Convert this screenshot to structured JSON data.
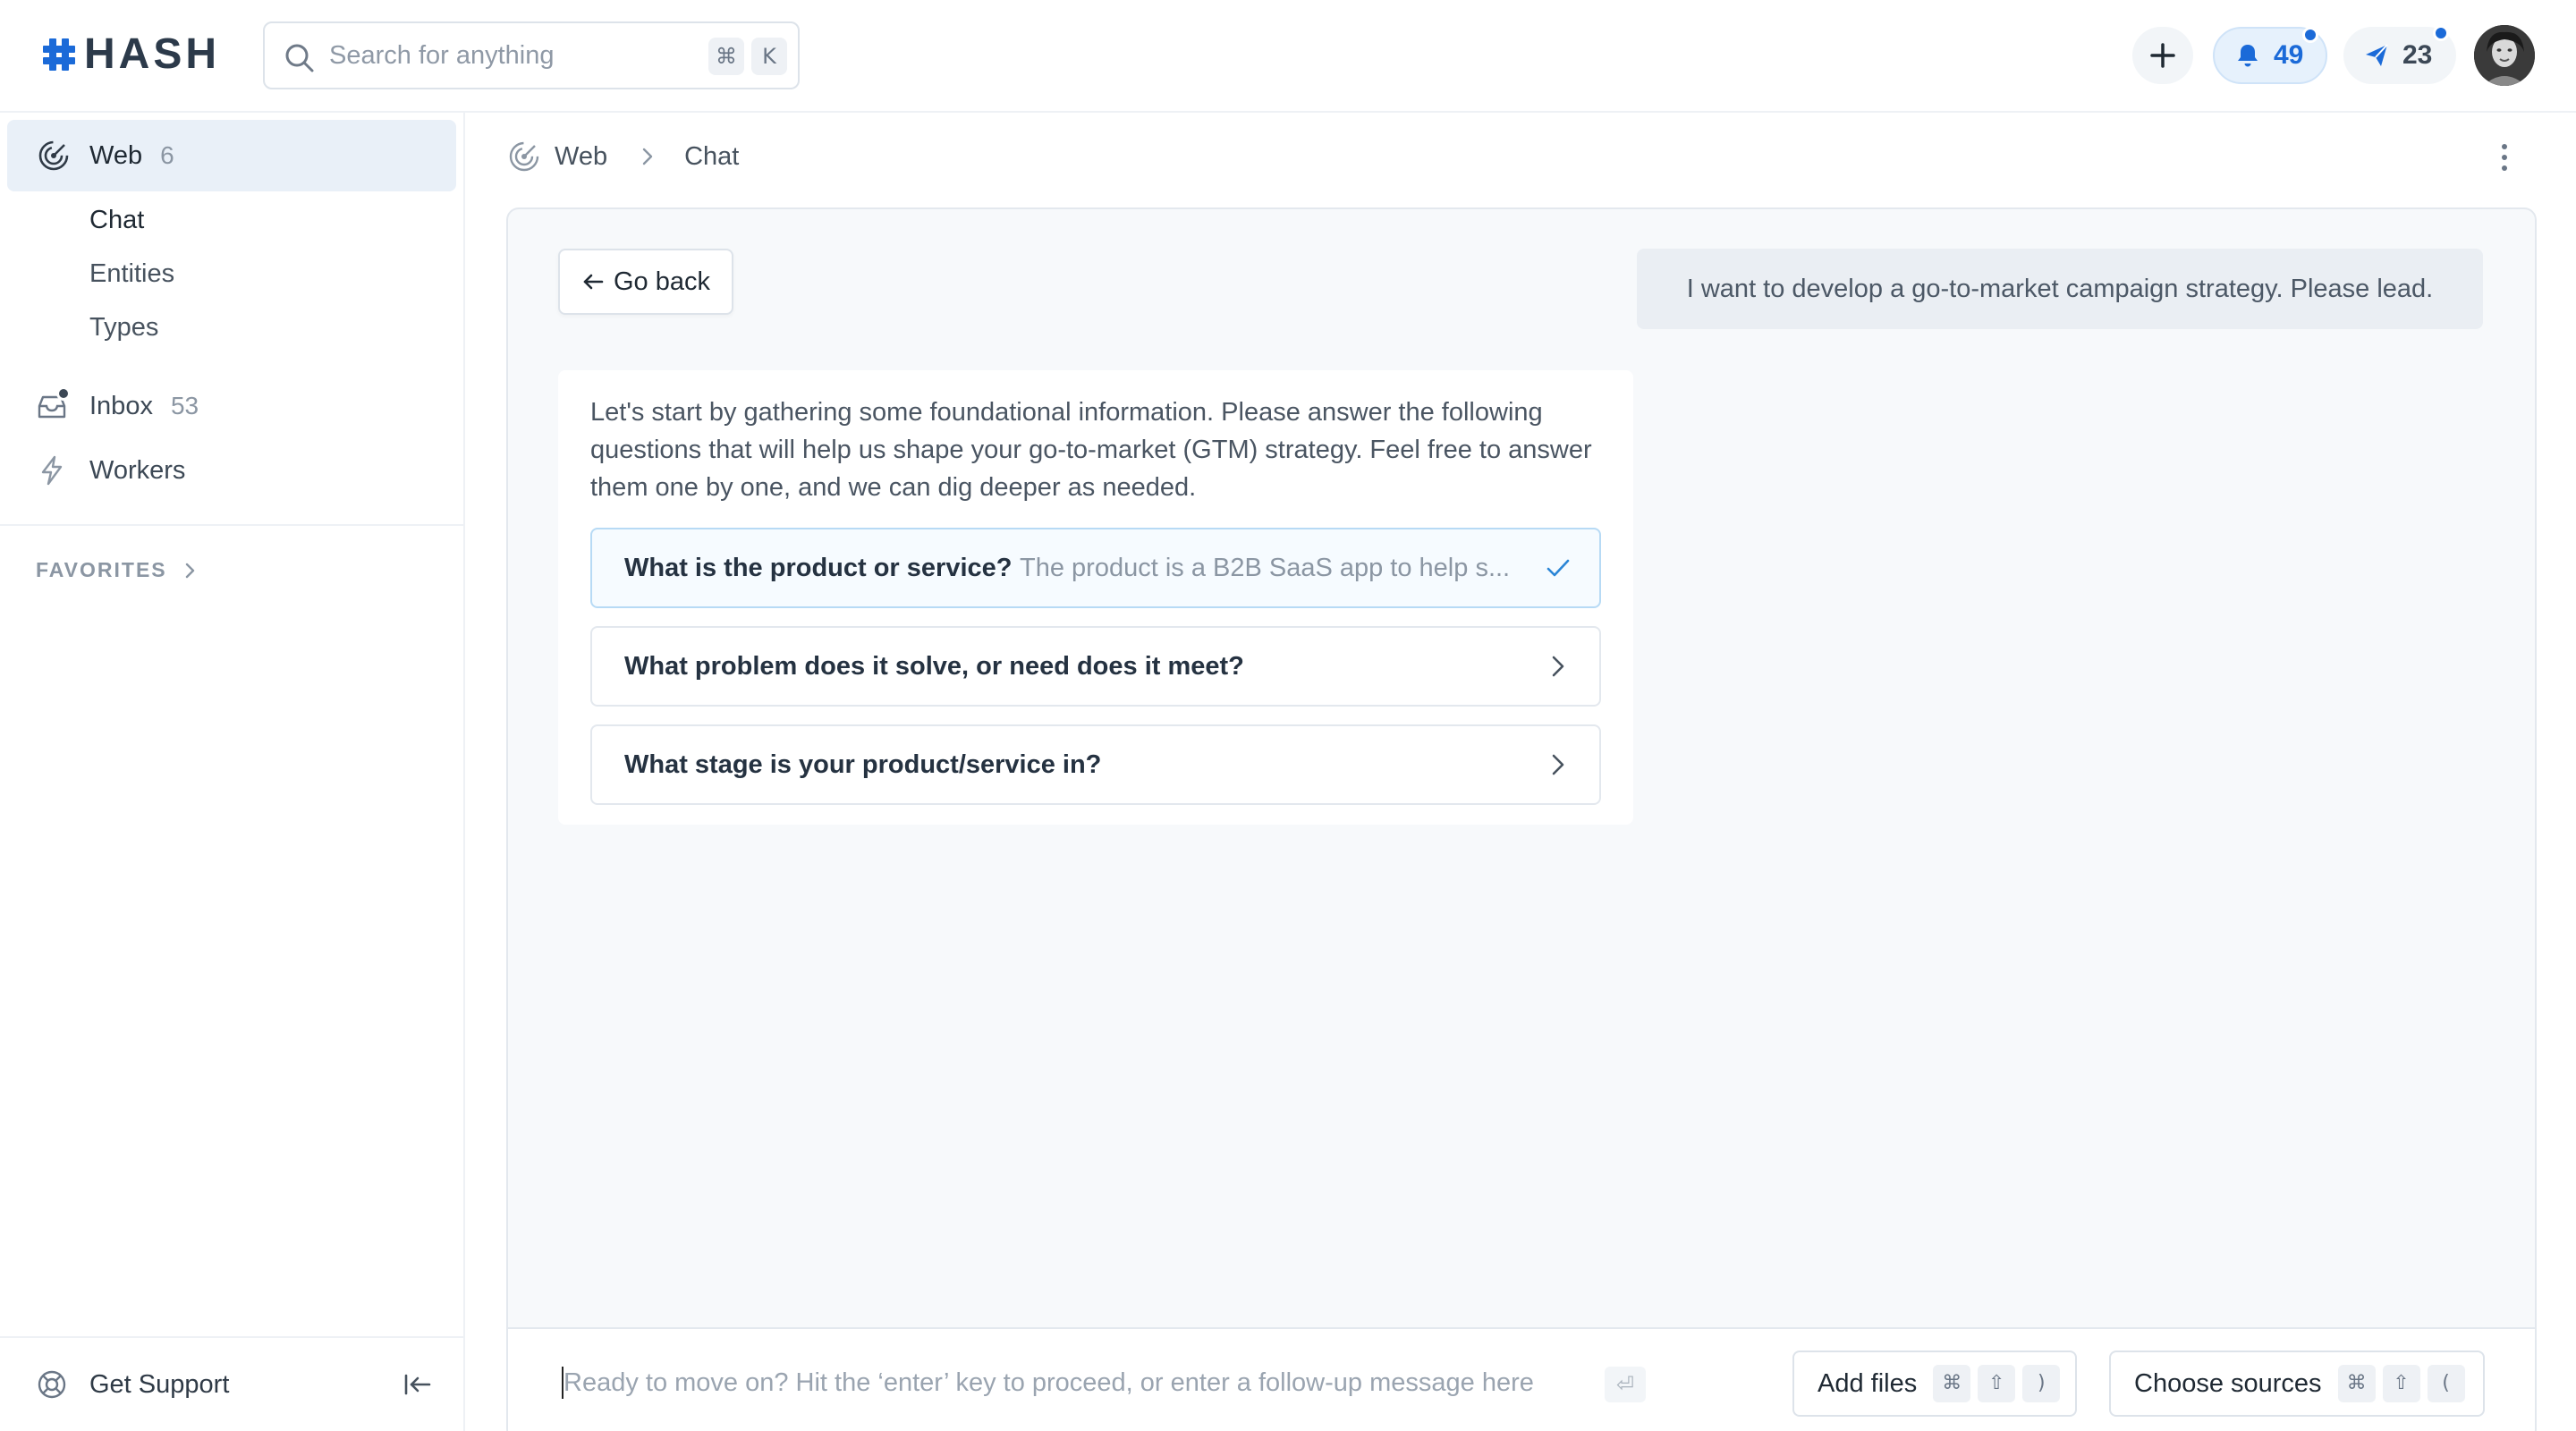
{
  "header": {
    "logo_text": "HASH",
    "search": {
      "placeholder": "Search for anything",
      "shortcut_cmd": "⌘",
      "shortcut_key": "K"
    },
    "notifications_count": "49",
    "messages_count": "23"
  },
  "sidebar": {
    "web": {
      "label": "Web",
      "count": "6"
    },
    "sub_items": [
      "Chat",
      "Entities",
      "Types"
    ],
    "inbox": {
      "label": "Inbox",
      "count": "53"
    },
    "workers": {
      "label": "Workers"
    },
    "favorites_label": "FAVORITES",
    "support_label": "Get Support"
  },
  "breadcrumb": {
    "root": "Web",
    "current": "Chat"
  },
  "chat": {
    "go_back_label": "Go back",
    "user_message": "I want to develop a go-to-market campaign strategy. Please lead.",
    "assistant_text": "Let's start by gathering some foundational information. Please answer the following questions that will help us shape your go-to-market (GTM) strategy. Feel free to answer them one by one, and we can dig deeper as needed.",
    "questions": [
      {
        "title": "What is the product or service?",
        "answer": "The product is a B2B SaaS app to help s...",
        "status": "answered"
      },
      {
        "title": "What problem does it solve, or need does it meet?",
        "answer": "",
        "status": "open"
      },
      {
        "title": "What stage is your product/service in?",
        "answer": "",
        "status": "open"
      }
    ]
  },
  "composer": {
    "placeholder": "Ready to move on? Hit the ‘enter’ key to proceed, or enter a follow-up message here",
    "enter_key": "⏎",
    "add_files": {
      "label": "Add files",
      "keys": [
        "⌘",
        "⇧",
        ")"
      ]
    },
    "choose_sources": {
      "label": "Choose sources",
      "keys": [
        "⌘",
        "⇧",
        "("
      ]
    }
  },
  "colors": {
    "accent": "#1b6ad8",
    "text": "#1f2933",
    "muted": "#8b96a3"
  }
}
